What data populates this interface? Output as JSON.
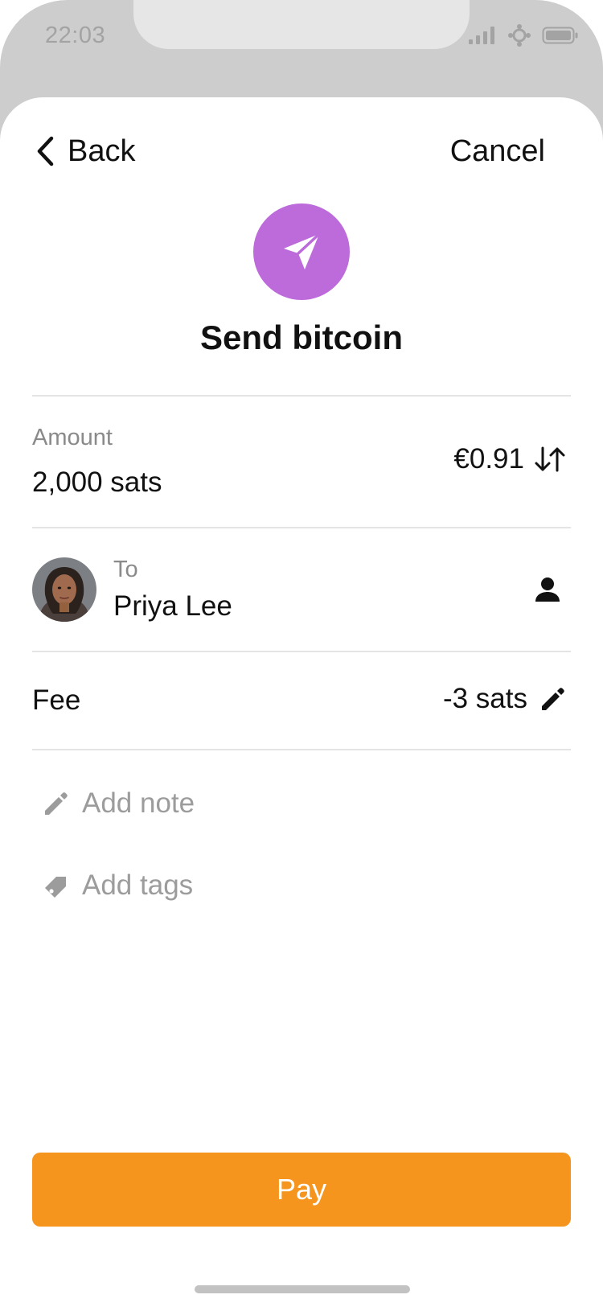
{
  "status_bar": {
    "time": "22:03"
  },
  "nav": {
    "back_label": "Back",
    "cancel_label": "Cancel"
  },
  "header": {
    "title": "Send bitcoin",
    "icon": "paper-plane-icon"
  },
  "amount": {
    "label": "Amount",
    "value": "2,000 sats",
    "fiat_value": "€0.91",
    "swap_icon": "swap-arrows-icon"
  },
  "recipient": {
    "label": "To",
    "name": "Priya Lee",
    "contact_icon": "person-icon"
  },
  "fee": {
    "label": "Fee",
    "value": "-3 sats",
    "edit_icon": "pencil-icon"
  },
  "note": {
    "placeholder": "Add note",
    "icon": "pencil-icon"
  },
  "tags": {
    "placeholder": "Add tags",
    "icon": "tag-icon"
  },
  "actions": {
    "pay_label": "Pay"
  },
  "colors": {
    "accent_purple": "#bd6bdb",
    "pay_orange": "#f6951e",
    "frame_gray": "#cdcdcd",
    "divider": "#e4e4e4",
    "muted_text": "#8a8a8a",
    "placeholder_text": "#9c9c9c"
  }
}
